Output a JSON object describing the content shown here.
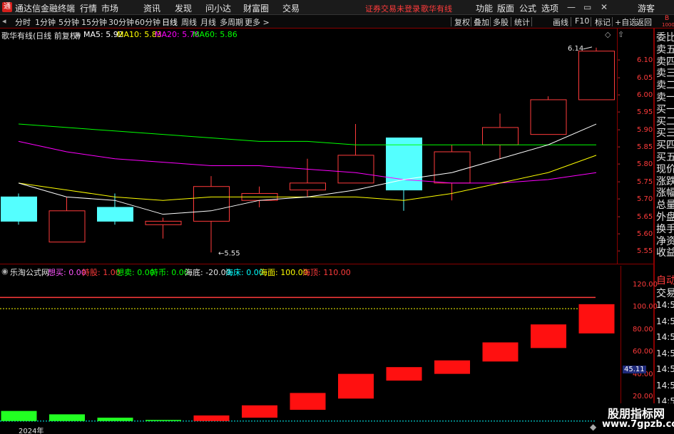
{
  "titlebar": {
    "logo": "通",
    "app_title": "通达信金融终端",
    "menus": [
      "行情",
      "市场",
      "资讯",
      "发现",
      "问小达",
      "财富圈",
      "交易"
    ],
    "warning": "证券交易未登录",
    "stock_name": "歌华有线",
    "right_menus": [
      "功能",
      "版面",
      "公式",
      "选项"
    ],
    "user": "游客",
    "min_icon": "minimize-icon",
    "restore_icon": "restore-icon",
    "close_icon": "close-icon"
  },
  "periodbar": {
    "items": [
      "分时",
      "1分钟",
      "5分钟",
      "15分钟",
      "30分钟",
      "60分钟",
      "日线",
      "周线",
      "月线",
      "多周期",
      "更多 >"
    ],
    "active": "日线",
    "tools": [
      "复权",
      "叠加",
      "多股",
      "统计",
      "画线",
      "F10",
      "标记",
      "+自选",
      "返回"
    ],
    "corner_top": "B",
    "corner_bottom": "1000"
  },
  "infobar": {
    "title": "歌华有线(日线 前复权)",
    "ma5": "MA5: 5.92",
    "ma10": "MA10: 5.83",
    "ma20": "MA20: 5.78",
    "ma60": "MA60: 5.86",
    "colors": {
      "ma5": "#ffffff",
      "ma10": "#ffff00",
      "ma20": "#ff00ff",
      "ma60": "#00ff00"
    }
  },
  "side": {
    "items": [
      "委比",
      "卖五",
      "卖四",
      "卖三",
      "卖二",
      "卖一",
      "买一",
      "买二",
      "买三",
      "买四",
      "买五",
      "现价",
      "涨跌",
      "涨幅",
      "总量",
      "外盘",
      "换手",
      "净资",
      "收益"
    ],
    "lower_items": [
      "自动",
      "交易"
    ],
    "times": [
      "14:56",
      "14:56",
      "14:56",
      "14:56",
      "14:56",
      "14:56",
      "14:56",
      "14:56"
    ]
  },
  "price_axis": {
    "labels": [
      "6.10",
      "6.05",
      "6.00",
      "5.95",
      "5.90",
      "5.85",
      "5.80",
      "5.75",
      "5.70",
      "5.65",
      "5.60",
      "5.55"
    ]
  },
  "annotations": {
    "high": "6.14",
    "low": "5.55"
  },
  "indicator": {
    "name": "乐淘公式网",
    "fields": [
      {
        "label": "想买: 0.00",
        "color": "#ff55ff"
      },
      {
        "label": "持股: 1.00",
        "color": "#ff3b3b"
      },
      {
        "label": "想卖: 0.00",
        "color": "#00ff00"
      },
      {
        "label": "持币: 0.00",
        "color": "#00ff00"
      },
      {
        "label": "海底: -20.00",
        "color": "#e6e6e6"
      },
      {
        "label": "海床: 0.00",
        "color": "#00ffff"
      },
      {
        "label": "海面: 100.00",
        "color": "#ffff00"
      },
      {
        "label": "海顶: 110.00",
        "color": "#ff3b3b"
      }
    ],
    "axis_labels": [
      "120.00",
      "100.00",
      "80.00",
      "60.00",
      "40.00",
      "20.00",
      "0.00"
    ],
    "current_value": "45.11"
  },
  "bottom": {
    "year": "2024年"
  },
  "watermark": {
    "line1": "股朋指标网",
    "line2": "www.7gpzb.com"
  },
  "chart_data": {
    "type": "candlestick",
    "candles": [
      {
        "open": 5.64,
        "high": 5.72,
        "low": 5.63,
        "close": 5.71,
        "dir": "up"
      },
      {
        "open": 5.67,
        "high": 5.71,
        "low": 5.58,
        "close": 5.58,
        "dir": "down"
      },
      {
        "open": 5.64,
        "high": 5.72,
        "low": 5.63,
        "close": 5.68,
        "dir": "up"
      },
      {
        "open": 5.64,
        "high": 5.65,
        "low": 5.59,
        "close": 5.63,
        "dir": "down"
      },
      {
        "open": 5.74,
        "high": 5.77,
        "low": 5.55,
        "close": 5.64,
        "dir": "down"
      },
      {
        "open": 5.72,
        "high": 5.74,
        "low": 5.68,
        "close": 5.7,
        "dir": "down"
      },
      {
        "open": 5.75,
        "high": 5.82,
        "low": 5.71,
        "close": 5.73,
        "dir": "down"
      },
      {
        "open": 5.83,
        "high": 5.92,
        "low": 5.76,
        "close": 5.75,
        "dir": "down"
      },
      {
        "open": 5.73,
        "high": 5.88,
        "low": 5.67,
        "close": 5.88,
        "dir": "up"
      },
      {
        "open": 5.84,
        "high": 5.86,
        "low": 5.7,
        "close": 5.75,
        "dir": "down"
      },
      {
        "open": 5.91,
        "high": 5.95,
        "low": 5.82,
        "close": 5.86,
        "dir": "down"
      },
      {
        "open": 5.99,
        "high": 6.0,
        "low": 5.89,
        "close": 5.89,
        "dir": "down"
      },
      {
        "open": 6.13,
        "high": 6.14,
        "low": 5.99,
        "close": 5.99,
        "dir": "down"
      }
    ],
    "ma5": [
      5.75,
      5.71,
      5.7,
      5.66,
      5.67,
      5.7,
      5.71,
      5.73,
      5.76,
      5.78,
      5.82,
      5.86,
      5.92
    ],
    "ma10": [
      5.75,
      5.73,
      5.71,
      5.7,
      5.71,
      5.71,
      5.71,
      5.71,
      5.7,
      5.72,
      5.75,
      5.78,
      5.83
    ],
    "ma20": [
      5.87,
      5.84,
      5.82,
      5.81,
      5.8,
      5.8,
      5.79,
      5.78,
      5.76,
      5.75,
      5.75,
      5.76,
      5.78
    ],
    "ma60": [
      5.92,
      5.91,
      5.9,
      5.89,
      5.88,
      5.87,
      5.87,
      5.86,
      5.86,
      5.86,
      5.86,
      5.86,
      5.86
    ],
    "ylim": [
      5.53,
      6.15
    ],
    "indicator_bars": [
      {
        "low": 0,
        "high": 9,
        "color": "green"
      },
      {
        "low": 0,
        "high": 6,
        "color": "green"
      },
      {
        "low": 0,
        "high": 3,
        "color": "green"
      },
      {
        "low": 0,
        "high": 1,
        "color": "green"
      },
      {
        "low": 0,
        "high": 5,
        "color": "red"
      },
      {
        "low": 3,
        "high": 14,
        "color": "red"
      },
      {
        "low": 10,
        "high": 25,
        "color": "red"
      },
      {
        "low": 20,
        "high": 42,
        "color": "red"
      },
      {
        "low": 36,
        "high": 48,
        "color": "red"
      },
      {
        "low": 42,
        "high": 54,
        "color": "red"
      },
      {
        "low": 53,
        "high": 70,
        "color": "red"
      },
      {
        "low": 65,
        "high": 86,
        "color": "red"
      },
      {
        "low": 78,
        "high": 104,
        "color": "red"
      }
    ],
    "indicator_ylim": [
      -2,
      128
    ],
    "indicator_lines": {
      "haiding": 110,
      "haimian": 100,
      "haichuang": 0
    }
  }
}
